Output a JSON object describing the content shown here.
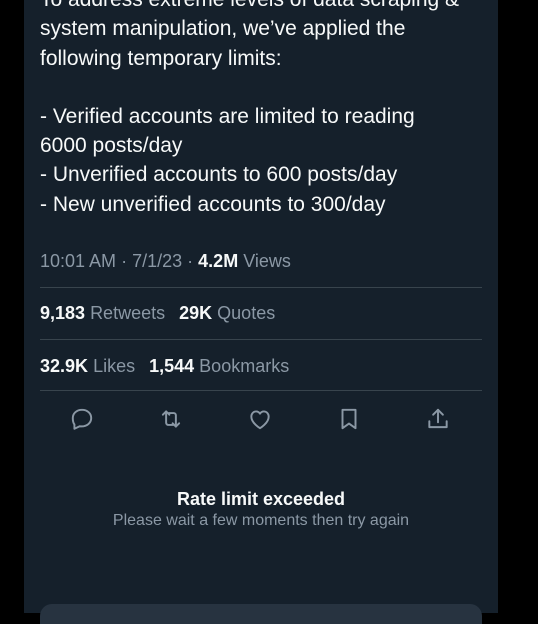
{
  "tweet": {
    "lines": [
      "To address extreme levels of data scraping &",
      "system manipulation, we’ve applied the",
      "following temporary limits:",
      "- Verified accounts are limited to reading",
      "6000 posts/day",
      "- Unverified accounts to 600 posts/day",
      "- New unverified accounts to 300/day"
    ]
  },
  "meta": {
    "time": "10:01 AM",
    "separator": "·",
    "date": "7/1/23",
    "views_count": "4.2M",
    "views_label": "Views"
  },
  "stats": {
    "retweets_count": "9,183",
    "retweets_label": "Retweets",
    "quotes_count": "29K",
    "quotes_label": "Quotes",
    "likes_count": "32.9K",
    "likes_label": "Likes",
    "bookmarks_count": "1,544",
    "bookmarks_label": "Bookmarks"
  },
  "actions": {
    "icons": [
      "reply-icon",
      "retweet-icon",
      "like-icon",
      "bookmark-icon",
      "share-icon"
    ]
  },
  "error": {
    "title": "Rate limit exceeded",
    "message": "Please wait a few moments then try again"
  },
  "colors": {
    "background": "#15202b",
    "text_primary": "#f7f9f9",
    "text_secondary": "#8b98a5",
    "divider": "#38444d",
    "accent": "#1d9bf0"
  }
}
